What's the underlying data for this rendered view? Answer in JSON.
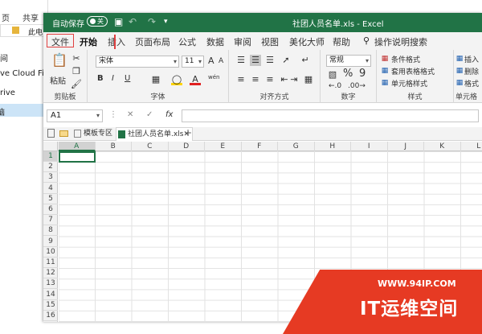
{
  "explorer": {
    "tabs": [
      "页",
      "共享"
    ],
    "path": "此电",
    "items": [
      "间",
      "ve Cloud File",
      "rive",
      "脑"
    ]
  },
  "window": {
    "autosave_label": "自动保存",
    "toggle_state": "关",
    "title": "社团人员名单.xls - Excel",
    "accent": "#217346"
  },
  "ribbon_tabs": [
    "文件",
    "开始",
    "插入",
    "页面布局",
    "公式",
    "数据",
    "审阅",
    "视图",
    "美化大师",
    "帮助"
  ],
  "search_label": "操作说明搜索",
  "ribbon": {
    "clipboard": {
      "label": "剪贴板",
      "paste": "粘贴"
    },
    "font": {
      "label": "字体",
      "name": "宋体",
      "size": "11",
      "bold": "B",
      "italic": "I",
      "underline": "U",
      "grow": "A",
      "shrink": "A",
      "wen": "wén"
    },
    "alignment": {
      "label": "对齐方式"
    },
    "number": {
      "label": "数字",
      "format": "常规",
      "percent": "%",
      "comma": "9"
    },
    "styles": {
      "label": "样式",
      "conditional": "条件格式",
      "table": "套用表格格式",
      "cell": "单元格样式"
    },
    "cells": {
      "label": "单元格",
      "insert": "插入",
      "delete": "删除",
      "format": "格式"
    }
  },
  "formula_bar": {
    "name_box": "A1",
    "fx": "fx",
    "cancel": "✕",
    "enter": "✓",
    "value": ""
  },
  "workbook_tabs": [
    {
      "label": "模板专区"
    },
    {
      "label": "社团人员名单.xls"
    }
  ],
  "add_tab": "+",
  "grid": {
    "columns": [
      "A",
      "B",
      "C",
      "D",
      "E",
      "F",
      "G",
      "H",
      "I",
      "J",
      "K",
      "L"
    ],
    "rows": [
      "1",
      "2",
      "3",
      "4",
      "5",
      "6",
      "7",
      "8",
      "9",
      "10",
      "11",
      "12",
      "13",
      "14",
      "15",
      "16"
    ],
    "active_cell": "A1"
  },
  "watermark": {
    "url": "WWW.94IP.COM",
    "name": "IT运维空间"
  }
}
